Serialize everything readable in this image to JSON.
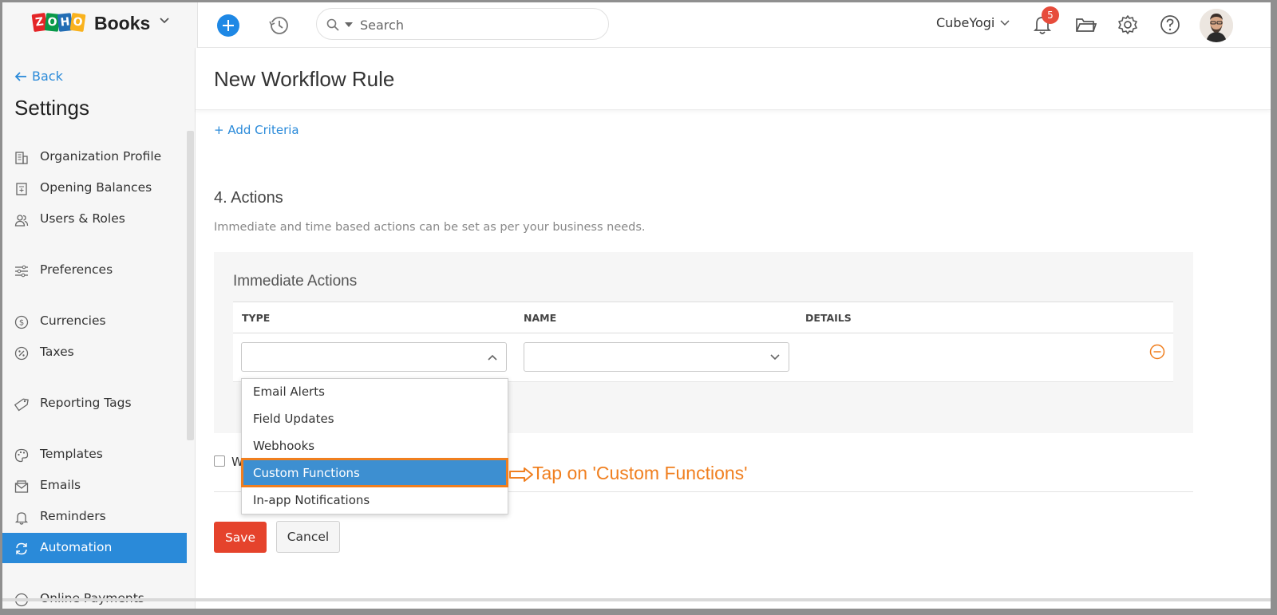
{
  "app": {
    "brand_letters": [
      "Z",
      "O",
      "H",
      "O"
    ],
    "product": "Books"
  },
  "topbar": {
    "search_placeholder": "Search",
    "org_name": "CubeYogi",
    "notification_count": "5"
  },
  "sidebar": {
    "back_label": "Back",
    "title": "Settings",
    "items": [
      {
        "label": "Organization Profile",
        "icon": "building-icon"
      },
      {
        "label": "Opening Balances",
        "icon": "ledger-icon"
      },
      {
        "label": "Users & Roles",
        "icon": "users-icon"
      },
      {
        "label": "Preferences",
        "icon": "sliders-icon"
      },
      {
        "label": "Currencies",
        "icon": "currency-icon"
      },
      {
        "label": "Taxes",
        "icon": "percent-icon"
      },
      {
        "label": "Reporting Tags",
        "icon": "tag-icon"
      },
      {
        "label": "Templates",
        "icon": "palette-icon"
      },
      {
        "label": "Emails",
        "icon": "envelope-icon"
      },
      {
        "label": "Reminders",
        "icon": "bell-icon"
      },
      {
        "label": "Automation",
        "icon": "refresh-icon",
        "active": true
      },
      {
        "label": "Online Payments",
        "icon": "payment-icon"
      }
    ]
  },
  "main": {
    "page_title": "New Workflow Rule",
    "add_criteria": "+ Add Criteria",
    "section_title": "4. Actions",
    "section_desc": "Immediate and time based actions can be set as per your business needs.",
    "panel_title": "Immediate Actions",
    "columns": [
      "TYPE",
      "NAME",
      "DETAILS"
    ],
    "checkbox_label_partial": "W",
    "save_label": "Save",
    "cancel_label": "Cancel"
  },
  "dropdown": {
    "options": [
      "Email Alerts",
      "Field Updates",
      "Webhooks",
      "Custom Functions",
      "In-app Notifications"
    ],
    "highlighted": "Custom Functions"
  },
  "annotation": {
    "text": "Tap on 'Custom Functions'"
  },
  "colors": {
    "accent": "#2a8ad9",
    "save": "#e5432c",
    "annotation": "#f07f1f",
    "badge": "#e74c3c"
  }
}
